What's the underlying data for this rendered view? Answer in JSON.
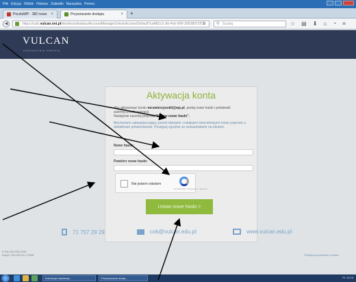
{
  "browser": {
    "menu": [
      "Plik",
      "Edycja",
      "Widok",
      "Historia",
      "Zakładki",
      "Narzędzia",
      "Pomoc"
    ],
    "tabs": [
      {
        "label": "PocztaWP - 382 nowe"
      },
      {
        "label": "Przywracanie dostępu"
      }
    ],
    "url_prefix": "https://cufs.",
    "url_domain": "vulcan.net.pl",
    "url_rest": "/ekonkursdostepu/AccountManage/UnlockAccess/Default?caAB1c3-Jkt-4nb-9fXf-39638072ICE",
    "search_placeholder": "Szukaj"
  },
  "header": {
    "logo": "VULCAN",
    "logo_sub": "ZARZĄDZANIE OŚWIATĄ"
  },
  "card": {
    "title": "Aktywacja konta",
    "p1_a": "Aby aktywować konto ",
    "p1_email": "mcswierzyoskli@wp.pl",
    "p1_b": ", podaj nowe hasło i potwierdź autentyczność operacji.",
    "p1_c": "Następnie naciśnij przycisk ",
    "p1_btn": "\"Ustaw nowe hasło\".",
    "p2": "Mechanizm zabezpieczający przed robotami i robakami internetowymi może poprosić o dodatkowe potwierdzenie. Postępuj zgodnie ze wskazówkami na ekranie.",
    "new_password_label": "Nowe hasło:",
    "repeat_password_label": "Powtórz nowe hasło:",
    "captcha_label": "Nie jestem robotem",
    "captcha_small": "reCAPTCHA · Prywatność · Warunki",
    "submit": "Ustaw nowe hasło >"
  },
  "contact": {
    "phone": "71 757 29 29",
    "email": "cok@vulcan.edu.pl",
    "web": "www.vulcan.edu.pl"
  },
  "footer": {
    "copyright": "© VULCAN 2012-2015",
    "version": "Kompil. VULCAN 15.1.2.3495",
    "privacy": "Polityka prywatności cookies"
  },
  "taskbar": {
    "items": [
      "Instrukcja rejestracji ...",
      "Przywracanie dostę..."
    ],
    "tray": "PL 10:15"
  },
  "colors": {
    "header": "#2f3b56",
    "accent": "#8fba3e",
    "link": "#7aa3c9"
  }
}
